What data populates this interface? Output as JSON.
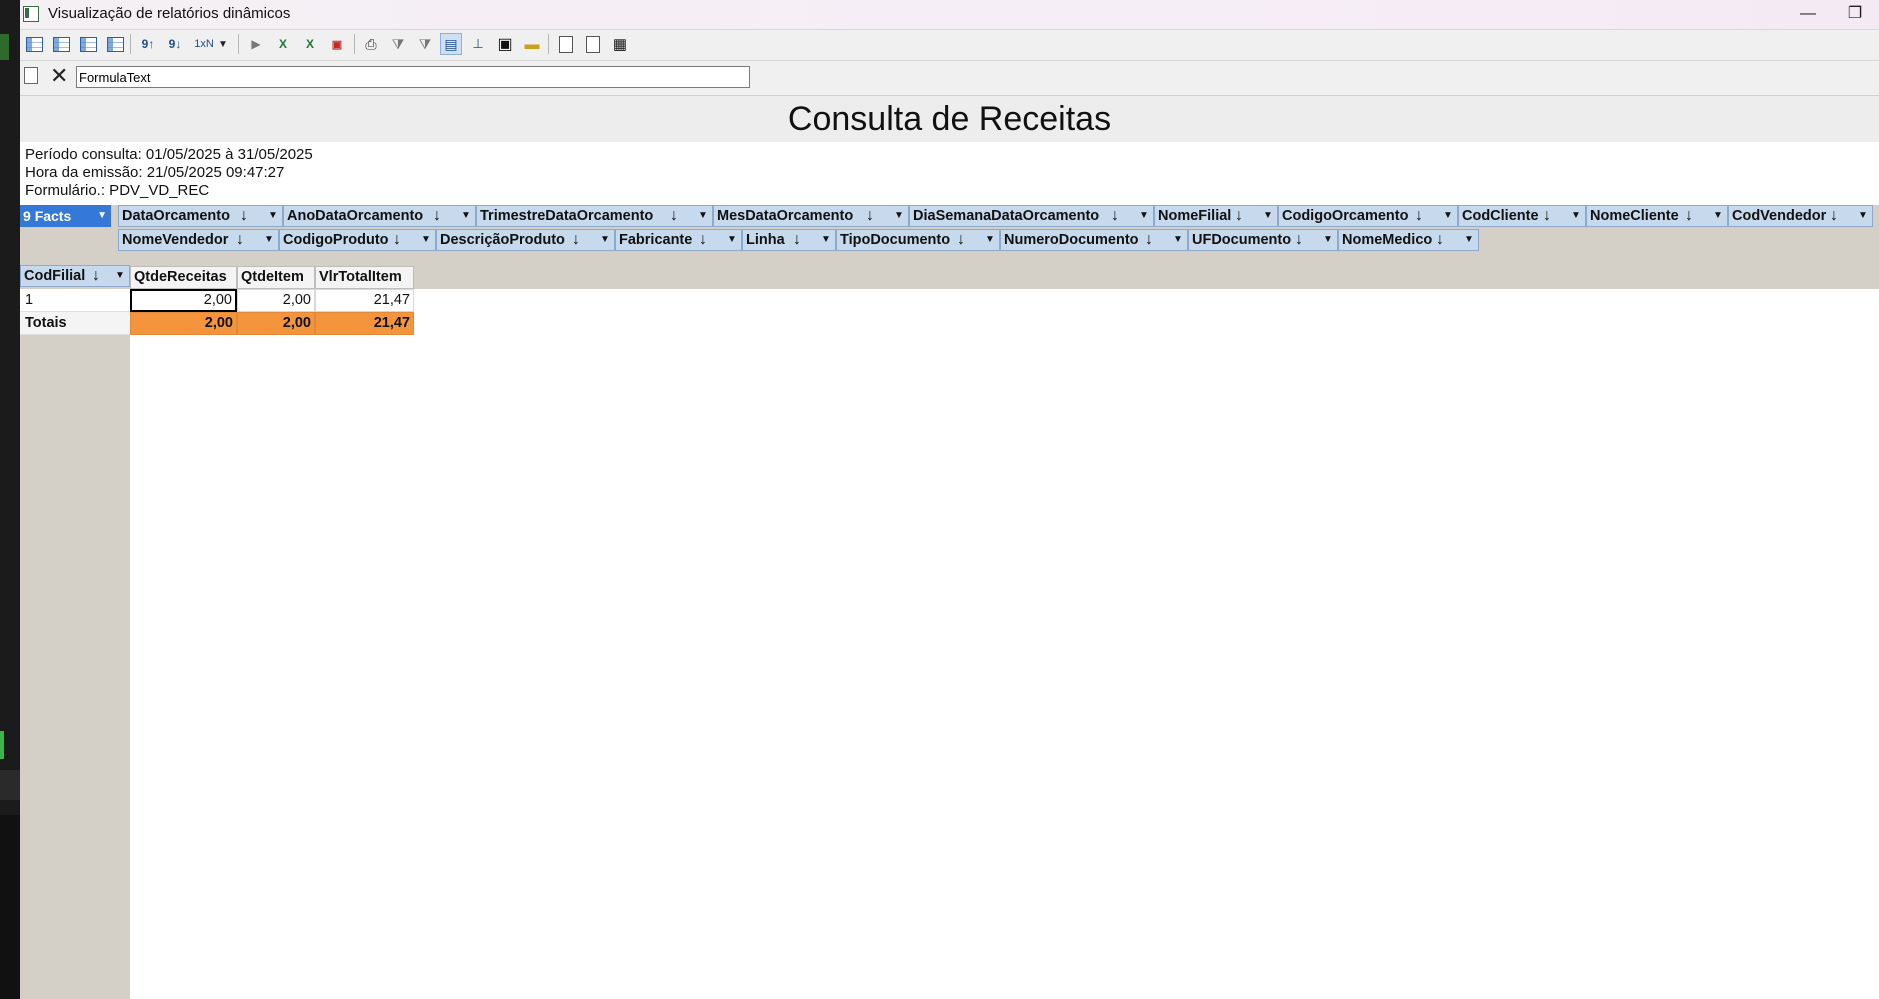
{
  "window": {
    "title": "Visualização de relatórios dinâmicos",
    "minimize_glyph": "—",
    "restore_glyph": "❐"
  },
  "toolbar": {
    "icons": [
      "grid-report-icon",
      "grid-report-icon",
      "grid-report-icon",
      "grid-report-icon",
      "sort-ascending-icon",
      "sort-descending-icon",
      "top-n-icon",
      "dropdown-arrow-icon",
      "export-icon",
      "excel-export-icon",
      "excel-export-icon",
      "pdf-export-icon",
      "print-icon",
      "filter-icon",
      "clear-filter-icon",
      "layout-icon",
      "tree-icon",
      "save-icon",
      "open-folder-icon",
      "page-icon",
      "page-icon",
      "clipboard-icon"
    ],
    "top_n_label": "1xN"
  },
  "formula": {
    "value": "FormulaText"
  },
  "report": {
    "title": "Consulta de Receitas",
    "info_lines": [
      "Período consulta: 01/05/2025 à 31/05/2025",
      "Hora da emissão: 21/05/2025 09:47:27",
      "Formulário.: PDV_VD_REC"
    ]
  },
  "facts_button": {
    "icon_text": "9",
    "label": "Facts"
  },
  "filter_fields_row1": [
    "DataOrcamento",
    "AnoDataOrcamento",
    "TrimestreDataOrcamento",
    "MesDataOrcamento",
    "DiaSemanaDataOrcamento",
    "NomeFilial",
    "CodigoOrcamento",
    "CodCliente",
    "NomeCliente",
    "CodVendedor"
  ],
  "filter_fields_row2": [
    "NomeVendedor",
    "CodigoProduto",
    "DescriçãoProduto",
    "Fabricante",
    "Linha",
    "TipoDocumento",
    "NumeroDocumento",
    "UFDocumento",
    "NomeMedico"
  ],
  "row_field": "CodFilial",
  "grid": {
    "columns": [
      "QtdeReceitas",
      "QtdeItem",
      "VlrTotalItem"
    ],
    "rows": [
      {
        "label": "1",
        "values": [
          "2,00",
          "2,00",
          "21,47"
        ]
      }
    ],
    "totals": {
      "label": "Totais",
      "values": [
        "2,00",
        "2,00",
        "21,47"
      ]
    }
  },
  "colors": {
    "facts_blue": "#3478d8",
    "field_header": "#c7d9ec",
    "totals_orange": "#f4943c",
    "panel_gray": "#d4d0c8"
  }
}
